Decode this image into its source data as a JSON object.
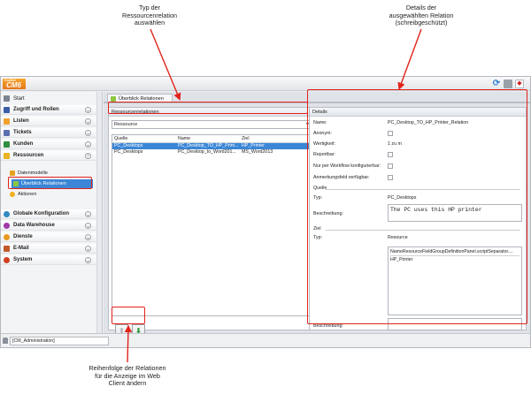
{
  "annotations": {
    "type_select": [
      "Typ der",
      "Ressourcenrelation",
      "auswählen"
    ],
    "details": [
      "Details der",
      "ausgewählten Relation",
      "(schreibgeschützt)"
    ],
    "order": [
      "Reihenfolge der Relationen",
      "für die Anzeige im Web",
      "Client ändern"
    ]
  },
  "app": {
    "logo_top": "ConSol",
    "logo_main": "CM6"
  },
  "sidebar": {
    "start": "Start",
    "items": [
      {
        "label": "Zugriff und Rollen",
        "icon": "shield-icon",
        "color": "#3a5fa8"
      },
      {
        "label": "Listen",
        "icon": "list-icon",
        "color": "#f0a030"
      },
      {
        "label": "Tickets",
        "icon": "ticket-icon",
        "color": "#5b6fb0"
      },
      {
        "label": "Kunden",
        "icon": "person-icon",
        "color": "#2f8e3f"
      },
      {
        "label": "Ressourcen",
        "icon": "resource-icon",
        "color": "#e8b422"
      }
    ],
    "sub_items": [
      {
        "label": "Datenmodelle",
        "icon": "datamodel-icon"
      },
      {
        "label": "Überblick Relationen",
        "icon": "relation-icon"
      },
      {
        "label": "Aktionen",
        "icon": "actions-icon"
      }
    ],
    "items_lower": [
      {
        "label": "Globale Konfiguration",
        "icon": "globe-icon",
        "color": "#2e8bc0"
      },
      {
        "label": "Data Warehouse",
        "icon": "warehouse-icon",
        "color": "#a03aa8"
      },
      {
        "label": "Dienste",
        "icon": "services-icon",
        "color": "#e89a20"
      },
      {
        "label": "E-Mail",
        "icon": "mail-icon",
        "color": "#c05a2a"
      },
      {
        "label": "System",
        "icon": "system-icon",
        "color": "#d04020"
      }
    ]
  },
  "content": {
    "tab_label": "Überblick Relationen",
    "left_panel": {
      "title": "Ressourcenrelationen",
      "dropdown_value": "Ressource",
      "columns": [
        "Quelle",
        "Name",
        "Ziel"
      ],
      "rows": [
        [
          "PC_Desktops",
          "PC_Desktop_TO_HP_Print...",
          "HP_Printer"
        ],
        [
          "PC_Desktops",
          "PC_Desktop_to_Word201...",
          "MS_Word2013"
        ]
      ]
    },
    "details": {
      "title": "Details",
      "name_label": "Name:",
      "name_value": "PC_Desktop_TO_HP_Printer_Relation",
      "anonym_label": "Anonym:",
      "wertigkeit_label": "Wertigkeit:",
      "wertigkeit_value": "1 zu m",
      "reportbar_label": "Reportbar:",
      "workflow_label": "Nur per Workflow konfigurierbar:",
      "anmerkung_label": "Anmerkungsfeld verfügbar:",
      "quelle_section": "Quelle",
      "quelle_typ_label": "Typ:",
      "quelle_typ_value": "PC_Desktops",
      "quelle_beschreibung_label": "Beschreibung:",
      "quelle_beschreibung_value": "The PC uses this HP printer",
      "ziel_section": "Ziel",
      "ziel_typ_label": "Typ:",
      "ziel_typ_value": "Resource",
      "ziel_list_line1": "NameResourceFieldGroupDefinitionPanel.scriptSeparator....",
      "ziel_list_line2": "HP_Printer",
      "ziel_beschreibung_label": "Beschreibung:"
    }
  },
  "status": {
    "user": "[CM_Administration]"
  }
}
